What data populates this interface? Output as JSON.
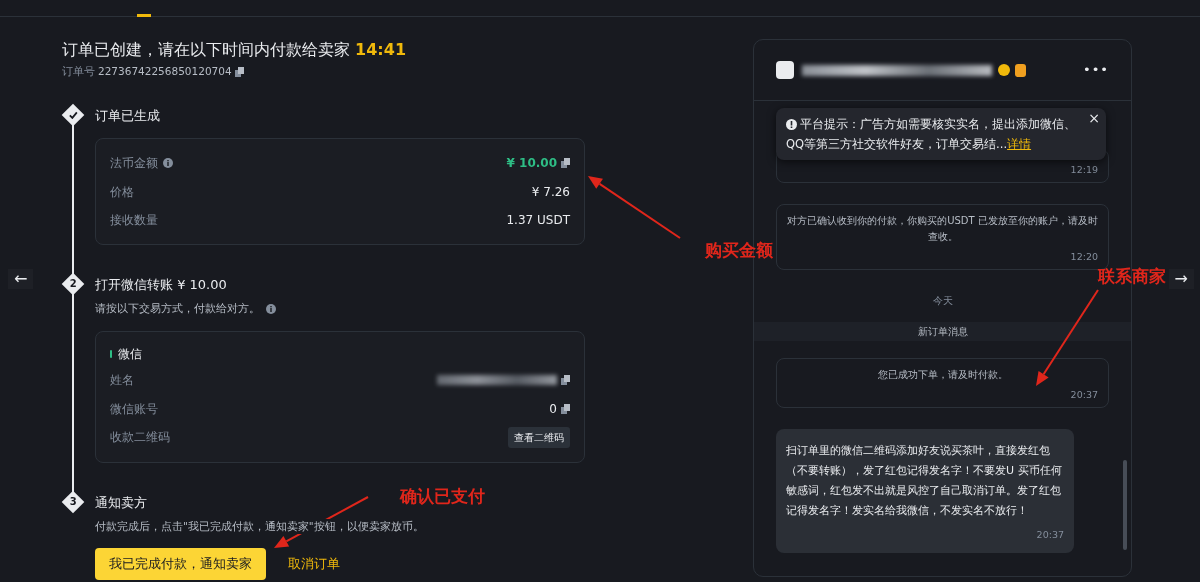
{
  "order": {
    "title": "订单已创建，请在以下时间内付款给卖家",
    "countdown": "14:41",
    "number_label": "订单号",
    "number": "22736742256850120704"
  },
  "steps": [
    {
      "done": true,
      "title": "订单已生成",
      "rows": [
        {
          "label": "法币金额",
          "info": true,
          "value": "¥ 10.00",
          "highlight": true,
          "copyable": true
        },
        {
          "label": "价格",
          "value": "¥ 7.26"
        },
        {
          "label": "接收数量",
          "value": "1.37 USDT"
        }
      ]
    },
    {
      "done": false,
      "number": "2",
      "title": "打开微信转账 ¥ 10.00",
      "note": "请按以下交易方式，付款给对方。",
      "note_info": true,
      "method": "微信",
      "rows": [
        {
          "label": "姓名",
          "redacted": true,
          "copyable": true
        },
        {
          "label": "微信账号",
          "value": "0",
          "copyable": true
        },
        {
          "label": "收款二维码",
          "button": "查看二维码"
        }
      ]
    },
    {
      "done": false,
      "number": "3",
      "title": "通知卖方",
      "note": "付款完成后，点击\"我已完成付款，通知卖家\"按钮，以便卖家放币。",
      "actions": [
        {
          "kind": "primary",
          "label": "我已完成付款，通知卖家"
        },
        {
          "kind": "link",
          "label": "取消订单"
        }
      ]
    }
  ],
  "nav": {
    "prev": "←",
    "next": "→"
  },
  "chat": {
    "seller_redacted": true,
    "more": "•••",
    "notice": {
      "text": "平台提示：广告方如需要核实实名，提出添加微信、QQ等第三方社交软件好友，订单交易结...",
      "link": "详情",
      "close": "×"
    },
    "messages": [
      {
        "kind": "system",
        "time": "12:19"
      },
      {
        "kind": "system",
        "text": "对方已确认收到你的付款，你购买的USDT 已发放至你的账户，请及时查收。",
        "time": "12:20"
      },
      {
        "kind": "date",
        "text": "今天"
      },
      {
        "kind": "banner",
        "text": "新订单消息"
      },
      {
        "kind": "system",
        "text": "您已成功下单，请及时付款。",
        "time": "20:37"
      },
      {
        "kind": "seller",
        "text": "扫订单里的微信二维码添加好友说买茶叶，直接发红包（不要转账），发了红包记得发名字！不要发U 买币任何敏感词，红包发不出就是风控了自己取消订单。发了红包记得发名字！发实名给我微信，不发实名不放行！",
        "time": "20:37"
      }
    ]
  },
  "annotations": [
    {
      "text": "购买金额"
    },
    {
      "text": "联系商家"
    },
    {
      "text": "确认已支付"
    }
  ]
}
